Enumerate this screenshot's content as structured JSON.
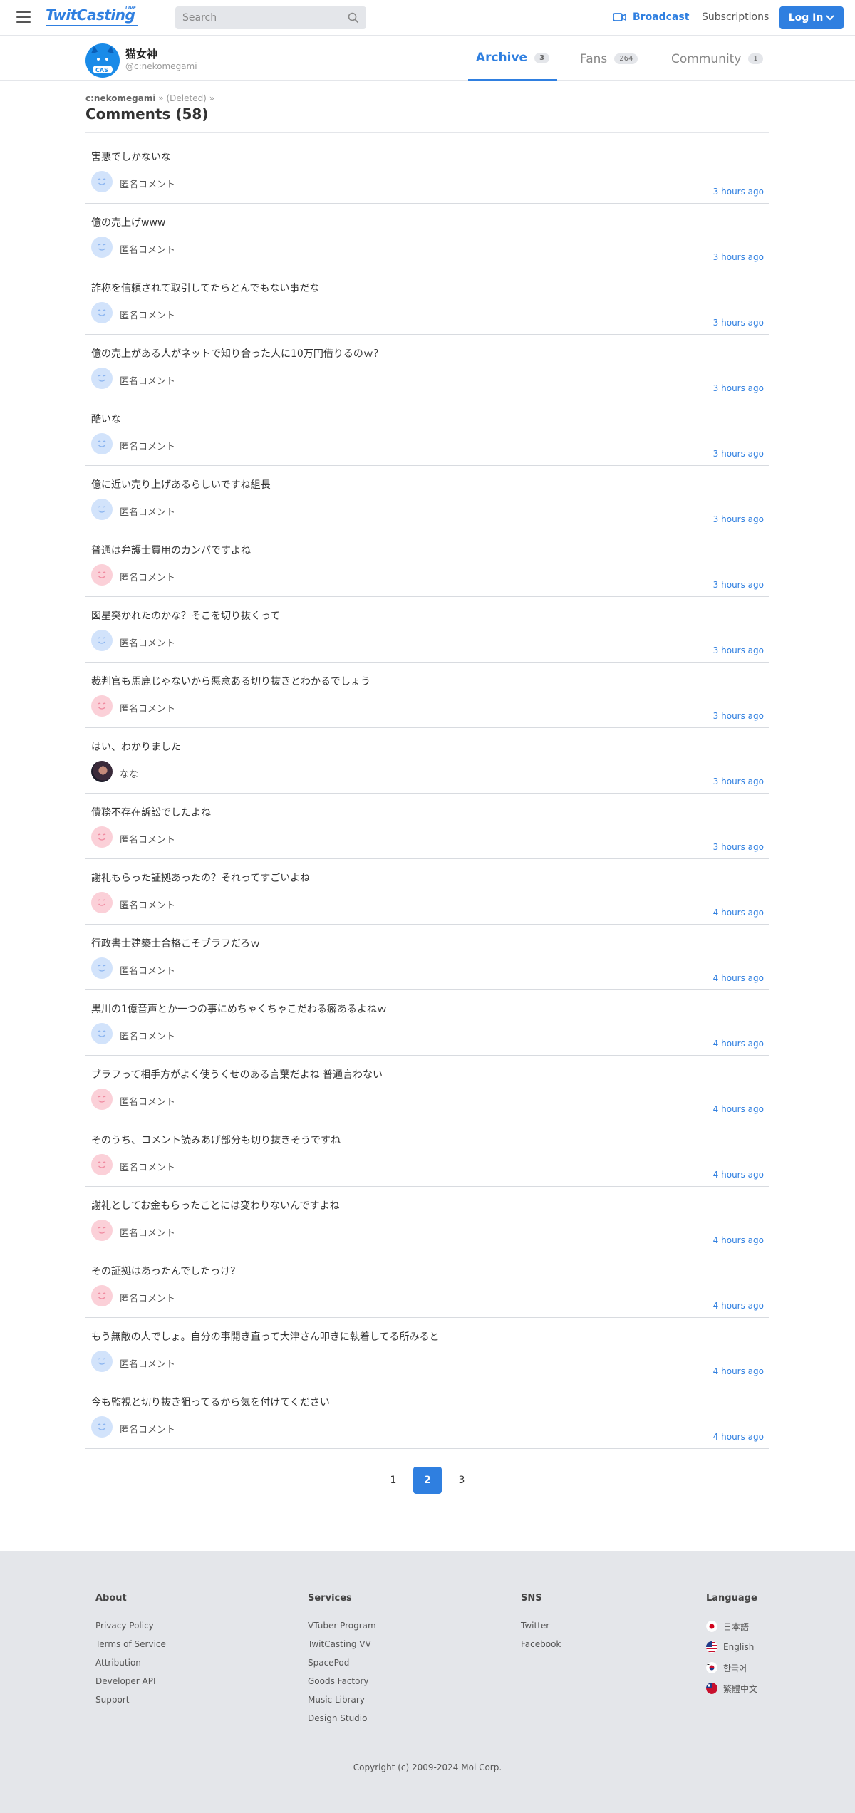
{
  "header": {
    "logo": "TwitCasting",
    "logo_badge": "LIVE",
    "search_placeholder": "Search",
    "broadcast": "Broadcast",
    "subscriptions": "Subscriptions",
    "login": "Log In"
  },
  "channel": {
    "name": "猫女神",
    "id": "@c:nekomegami",
    "avatar_label": "CAS"
  },
  "tabs": [
    {
      "label": "Archive",
      "count": "3"
    },
    {
      "label": "Fans",
      "count": "264"
    },
    {
      "label": "Community",
      "count": "1"
    }
  ],
  "breadcrumb": {
    "user": "c:nekomegami",
    "sep1": "»",
    "item": "(Deleted)",
    "sep2": "»"
  },
  "page_title": "Comments (58)",
  "comments": [
    {
      "text": "害悪でしかないな",
      "user": "匿名コメント",
      "time": "3 hours ago",
      "avatar": "blue"
    },
    {
      "text": "億の売上げwww",
      "user": "匿名コメント",
      "time": "3 hours ago",
      "avatar": "blue"
    },
    {
      "text": "詐称を信頼されて取引してたらとんでもない事だな",
      "user": "匿名コメント",
      "time": "3 hours ago",
      "avatar": "blue"
    },
    {
      "text": "億の売上がある人がネットで知り合った人に10万円借りるのｗ？",
      "user": "匿名コメント",
      "time": "3 hours ago",
      "avatar": "blue"
    },
    {
      "text": "酷いな",
      "user": "匿名コメント",
      "time": "3 hours ago",
      "avatar": "blue"
    },
    {
      "text": "億に近い売り上げあるらしいですね組長",
      "user": "匿名コメント",
      "time": "3 hours ago",
      "avatar": "blue"
    },
    {
      "text": "普通は弁護士費用のカンパですよね",
      "user": "匿名コメント",
      "time": "3 hours ago",
      "avatar": "pink"
    },
    {
      "text": "図星突かれたのかな？そこを切り抜くって",
      "user": "匿名コメント",
      "time": "3 hours ago",
      "avatar": "blue"
    },
    {
      "text": "裁判官も馬鹿じゃないから悪意ある切り抜きとわかるでしょう",
      "user": "匿名コメント",
      "time": "3 hours ago",
      "avatar": "pink"
    },
    {
      "text": "はい、わかりました",
      "user": "なな",
      "time": "3 hours ago",
      "avatar": "photo"
    },
    {
      "text": "債務不存在訴訟でしたよね",
      "user": "匿名コメント",
      "time": "3 hours ago",
      "avatar": "pink"
    },
    {
      "text": "謝礼もらった証拠あったの？それってすごいよね",
      "user": "匿名コメント",
      "time": "4 hours ago",
      "avatar": "pink"
    },
    {
      "text": "行政書士建築士合格こそブラフだろｗ",
      "user": "匿名コメント",
      "time": "4 hours ago",
      "avatar": "blue"
    },
    {
      "text": "黒川の1億音声とか一つの事にめちゃくちゃこだわる癖あるよねｗ",
      "user": "匿名コメント",
      "time": "4 hours ago",
      "avatar": "blue"
    },
    {
      "text": "ブラフって相手方がよく使うくせのある言葉だよね 普通言わない",
      "user": "匿名コメント",
      "time": "4 hours ago",
      "avatar": "pink"
    },
    {
      "text": "そのうち、コメント読みあげ部分も切り抜きそうですね",
      "user": "匿名コメント",
      "time": "4 hours ago",
      "avatar": "pink"
    },
    {
      "text": "謝礼としてお金もらったことには変わりないんですよね",
      "user": "匿名コメント",
      "time": "4 hours ago",
      "avatar": "pink"
    },
    {
      "text": "その証拠はあったんでしたっけ？",
      "user": "匿名コメント",
      "time": "4 hours ago",
      "avatar": "pink"
    },
    {
      "text": "もう無敵の人でしょ。自分の事開き直って大津さん叩きに執着してる所みると",
      "user": "匿名コメント",
      "time": "4 hours ago",
      "avatar": "blue"
    },
    {
      "text": "今も監視と切り抜き狙ってるから気を付けてください",
      "user": "匿名コメント",
      "time": "4 hours ago",
      "avatar": "blue"
    }
  ],
  "pagination": {
    "pages": [
      "1",
      "2",
      "3"
    ],
    "current": "2"
  },
  "footer": {
    "about": {
      "title": "About",
      "links": [
        "Privacy Policy",
        "Terms of Service",
        "Attribution",
        "Developer API",
        "Support"
      ]
    },
    "services": {
      "title": "Services",
      "links": [
        "VTuber Program",
        "TwitCasting VV",
        "SpacePod",
        "Goods Factory",
        "Music Library",
        "Design Studio"
      ]
    },
    "sns": {
      "title": "SNS",
      "links": [
        "Twitter",
        "Facebook"
      ]
    },
    "language": {
      "title": "Language",
      "items": [
        {
          "label": "日本語",
          "flag": "jp-flag-icon"
        },
        {
          "label": "English",
          "flag": "us-flag-icon"
        },
        {
          "label": "한국어",
          "flag": "kr-flag-icon"
        },
        {
          "label": "繁體中文",
          "flag": "tw-flag-icon"
        }
      ]
    },
    "copyright": "Copyright (c) 2009-2024 Moi Corp."
  },
  "colors": {
    "accent": "#2f7fe0",
    "footer_bg": "#e4e6ea"
  }
}
